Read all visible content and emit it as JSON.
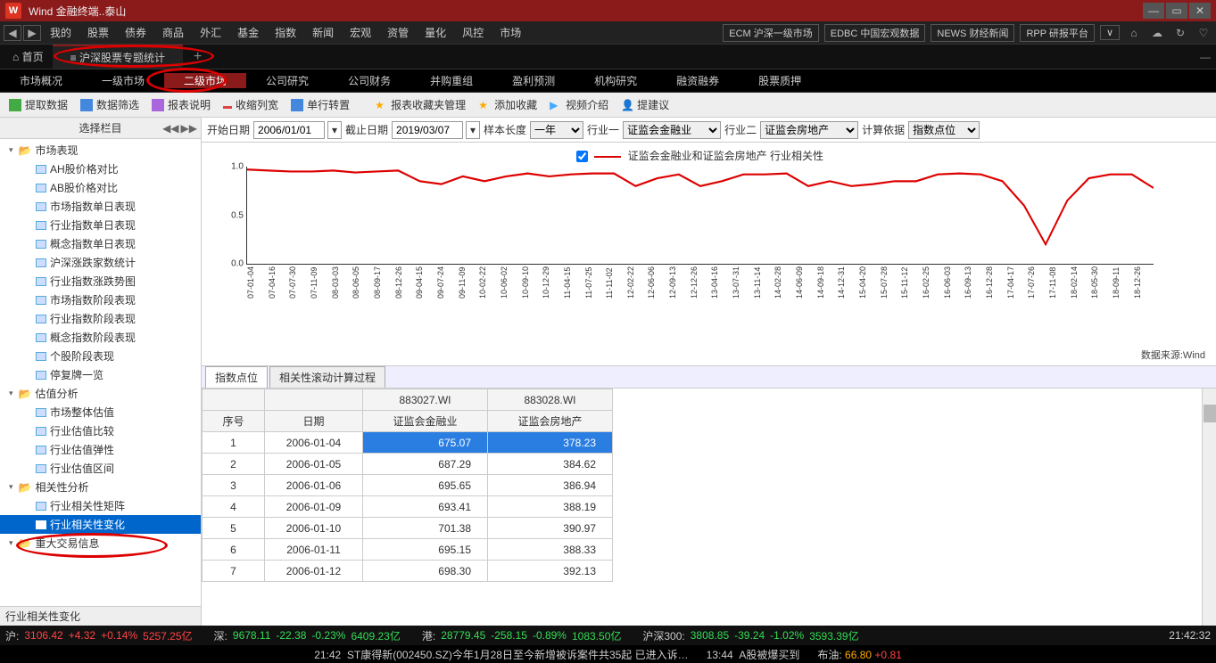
{
  "titlebar": {
    "app": "Wind 金融终端..泰山"
  },
  "menu": {
    "items": [
      "我的",
      "股票",
      "债券",
      "商品",
      "外汇",
      "基金",
      "指数",
      "新闻",
      "宏观",
      "资管",
      "量化",
      "风控",
      "市场"
    ],
    "quick": [
      "ECM 沪深一级市场",
      "EDBC 中国宏观数据",
      "NEWS 财经新闻",
      "RPP 研报平台"
    ]
  },
  "tabs": {
    "home": "首页",
    "active": "沪深股票专题统计"
  },
  "subnav": {
    "items": [
      "市场概况",
      "一级市场",
      "二级市场",
      "公司研究",
      "公司财务",
      "并购重组",
      "盈利预测",
      "机构研究",
      "融资融券",
      "股票质押"
    ],
    "activeIndex": 2
  },
  "toolbar": {
    "extract": "提取数据",
    "filter": "数据筛选",
    "reportDesc": "报表说明",
    "shrink": "收缩列宽",
    "transpose": "单行转置",
    "favMgr": "报表收藏夹管理",
    "addFav": "添加收藏",
    "video": "视频介绍",
    "suggest": "提建议"
  },
  "sidehdr": "选择栏目",
  "tree": {
    "g1": "市场表现",
    "g1items": [
      "AH股价格对比",
      "AB股价格对比",
      "市场指数单日表现",
      "行业指数单日表现",
      "概念指数单日表现",
      "沪深涨跌家数统计",
      "行业指数涨跌势图",
      "市场指数阶段表现",
      "行业指数阶段表现",
      "概念指数阶段表现",
      "个股阶段表现",
      "停复牌一览"
    ],
    "g2": "估值分析",
    "g2items": [
      "市场整体估值",
      "行业估值比较",
      "行业估值弹性",
      "行业估值区间"
    ],
    "g3": "相关性分析",
    "g3items": [
      "行业相关性矩阵",
      "行业相关性变化"
    ],
    "g4": "重大交易信息"
  },
  "sidefoot": "行业相关性变化",
  "filter": {
    "startLabel": "开始日期",
    "start": "2006/01/01",
    "endLabel": "截止日期",
    "end": "2019/03/07",
    "sampleLabel": "样本长度",
    "sample": "一年",
    "ind1Label": "行业一",
    "ind1": "证监会金融业",
    "ind2Label": "行业二",
    "ind2": "证监会房地产",
    "basisLabel": "计算依据",
    "basis": "指数点位"
  },
  "legend": "证监会金融业和证监会房地产 行业相关性",
  "datasrc": "数据来源:Wind",
  "chart_data": {
    "type": "line",
    "title": "证监会金融业和证监会房地产 行业相关性",
    "ylabel": "",
    "ylim": [
      0.0,
      1.0
    ],
    "yticks": [
      0.0,
      0.5,
      1.0
    ],
    "x": [
      "07-01-04",
      "07-04-16",
      "07-07-30",
      "07-11-09",
      "08-03-03",
      "08-06-05",
      "08-09-17",
      "08-12-26",
      "09-04-15",
      "09-07-24",
      "09-11-09",
      "10-02-22",
      "10-06-02",
      "10-09-10",
      "10-12-29",
      "11-04-15",
      "11-07-25",
      "11-11-02",
      "12-02-22",
      "12-06-06",
      "12-09-13",
      "12-12-26",
      "13-04-16",
      "13-07-31",
      "13-11-14",
      "14-02-28",
      "14-06-09",
      "14-09-18",
      "14-12-31",
      "15-04-20",
      "15-07-28",
      "15-11-12",
      "16-02-25",
      "16-06-03",
      "16-09-13",
      "16-12-28",
      "17-04-17",
      "17-07-26",
      "17-11-08",
      "18-02-14",
      "18-05-30",
      "18-09-11",
      "18-12-26"
    ],
    "values": [
      0.97,
      0.96,
      0.95,
      0.95,
      0.96,
      0.94,
      0.95,
      0.96,
      0.85,
      0.82,
      0.9,
      0.85,
      0.9,
      0.93,
      0.9,
      0.92,
      0.93,
      0.93,
      0.8,
      0.88,
      0.92,
      0.8,
      0.85,
      0.92,
      0.92,
      0.93,
      0.8,
      0.85,
      0.8,
      0.82,
      0.85,
      0.85,
      0.92,
      0.93,
      0.92,
      0.85,
      0.6,
      0.2,
      0.65,
      0.88,
      0.92,
      0.92,
      0.78
    ]
  },
  "tbltabs": {
    "t1": "指数点位",
    "t2": "相关性滚动计算过程"
  },
  "table": {
    "codes": [
      "883027.WI",
      "883028.WI"
    ],
    "headers": [
      "序号",
      "日期",
      "证监会金融业",
      "证监会房地产"
    ],
    "rows": [
      {
        "i": "1",
        "d": "2006-01-04",
        "a": "675.07",
        "b": "378.23"
      },
      {
        "i": "2",
        "d": "2006-01-05",
        "a": "687.29",
        "b": "384.62"
      },
      {
        "i": "3",
        "d": "2006-01-06",
        "a": "695.65",
        "b": "386.94"
      },
      {
        "i": "4",
        "d": "2006-01-09",
        "a": "693.41",
        "b": "388.19"
      },
      {
        "i": "5",
        "d": "2006-01-10",
        "a": "701.38",
        "b": "390.97"
      },
      {
        "i": "6",
        "d": "2006-01-11",
        "a": "695.15",
        "b": "388.33"
      },
      {
        "i": "7",
        "d": "2006-01-12",
        "a": "698.30",
        "b": "392.13"
      }
    ]
  },
  "ticker": {
    "hu": "沪:",
    "hu1": "3106.42",
    "hu2": "+4.32",
    "hu3": "+0.14%",
    "hu4": "5257.25亿",
    "shen": "深:",
    "shen1": "9678.11",
    "shen2": "-22.38",
    "shen3": "-0.23%",
    "shen4": "6409.23亿",
    "hk": "港:",
    "hk1": "28779.45",
    "hk2": "-258.15",
    "hk3": "-0.89%",
    "hk4": "1083.50亿",
    "hs300": "沪深300:",
    "hs1": "3808.85",
    "hs2": "-39.24",
    "hs3": "-1.02%",
    "hs4": "3593.39亿",
    "time": "21:42:32"
  },
  "news": {
    "n1t": "21:42",
    "n1": "ST康得新(002450.SZ)今年1月28日至今新增被诉案件共35起 已进入诉…",
    "n2t": "13:44",
    "n2": "A股被爆买到",
    "oil": "布油:",
    "oilp": "66.80",
    "oild": "+0.81"
  }
}
